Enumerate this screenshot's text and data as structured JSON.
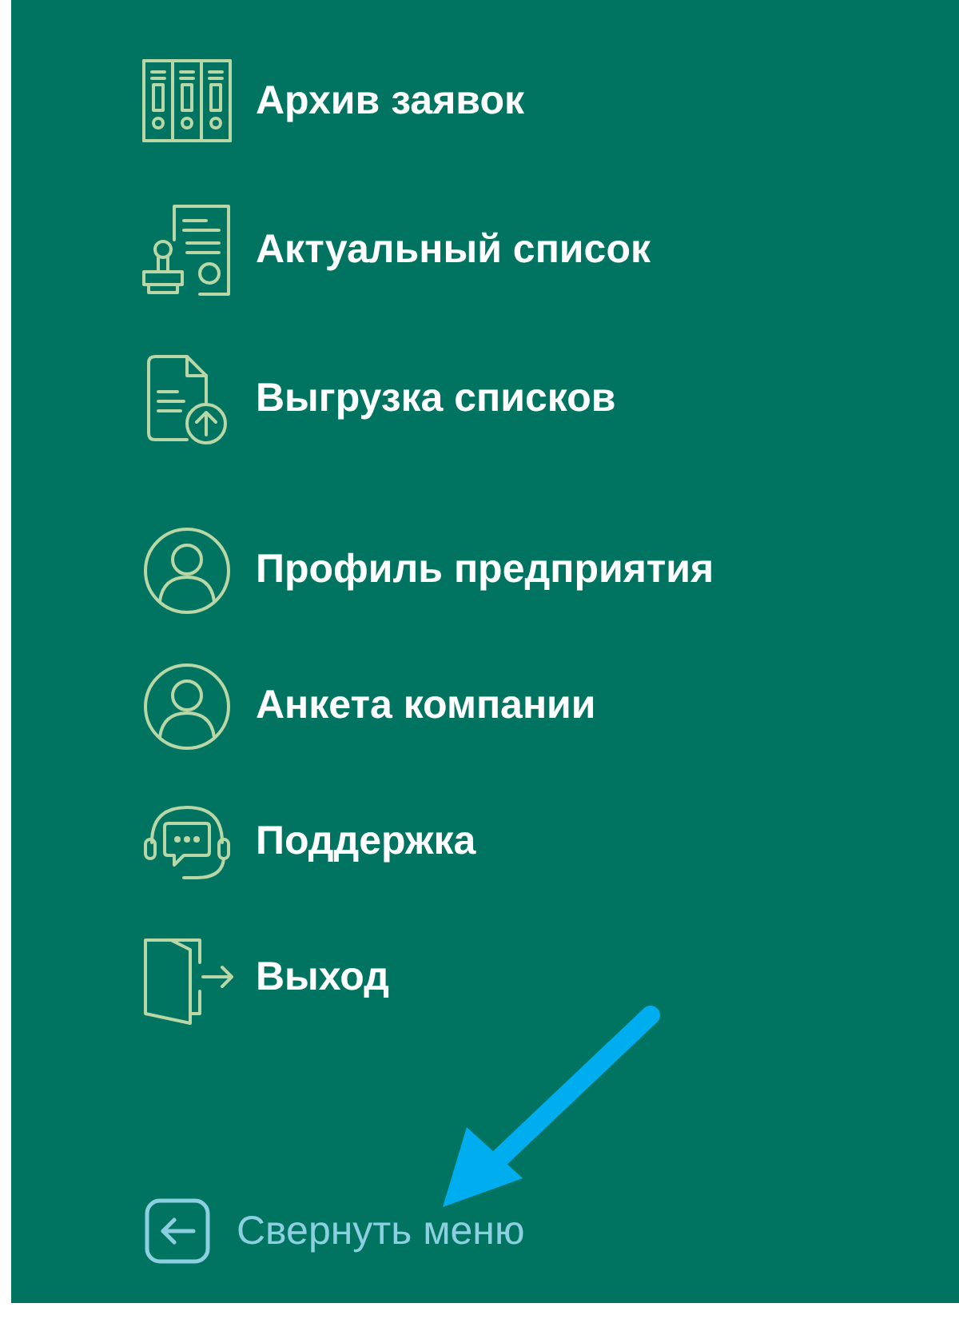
{
  "menu": {
    "sections": [
      {
        "items": [
          {
            "kind": "archive",
            "label": "Архив заявок"
          },
          {
            "kind": "stamp",
            "label": "Актуальный список"
          },
          {
            "kind": "upload",
            "label": "Выгрузка списков"
          }
        ]
      },
      {
        "items": [
          {
            "kind": "user",
            "label": "Профиль предприятия"
          },
          {
            "kind": "user",
            "label": "Анкета компании"
          },
          {
            "kind": "support",
            "label": "Поддержка"
          },
          {
            "kind": "exit",
            "label": "Выход"
          }
        ]
      }
    ]
  },
  "collapse": {
    "label": "Свернуть меню"
  }
}
